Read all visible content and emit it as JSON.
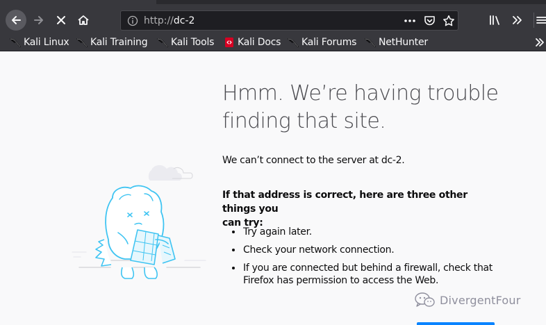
{
  "toolbar": {
    "url_scheme": "http://",
    "url_host": "dc-2",
    "icons": {
      "back": "back-arrow-icon",
      "forward": "forward-arrow-icon",
      "stop": "stop-x-icon",
      "home": "home-icon",
      "info": "info-icon",
      "page_actions": "ellipsis-icon",
      "pocket": "pocket-icon",
      "bookmark_star": "star-icon",
      "library": "library-icon",
      "overflow": "double-chevron-icon",
      "menu": "hamburger-icon"
    }
  },
  "bookmarks": [
    {
      "label": "Kali Linux",
      "icon": "kali-dragon-icon"
    },
    {
      "label": "Kali Training",
      "icon": "kali-dragon-icon"
    },
    {
      "label": "Kali Tools",
      "icon": "kali-dragon-icon"
    },
    {
      "label": "Kali Docs",
      "icon": "kali-docs-icon"
    },
    {
      "label": "Kali Forums",
      "icon": "kali-dragon-icon"
    },
    {
      "label": "NetHunter",
      "icon": "kali-dragon-icon"
    }
  ],
  "error": {
    "title_line1": "Hmm. We’re having trouble",
    "title_line2": "finding that site.",
    "description": "We can’t connect to the server at dc-2.",
    "suggestion_heading_line1": "If that address is correct, here are three other things you",
    "suggestion_heading_line2": "can try:",
    "tips": [
      {
        "line1": "Try again later.",
        "line2": ""
      },
      {
        "line1": "Check your network connection.",
        "line2": ""
      },
      {
        "line1": "If you are connected but behind a firewall, check that",
        "line2": "Firefox has permission to access the Web."
      }
    ]
  },
  "watermark": {
    "text": "DivergentFour",
    "icon": "wechat-icon"
  },
  "colors": {
    "toolbar": "#38383d",
    "urlbar": "#1e1e22",
    "page": "#f9f9fa",
    "accent": "#0a84ff",
    "illustration": "#3fc4f2"
  }
}
